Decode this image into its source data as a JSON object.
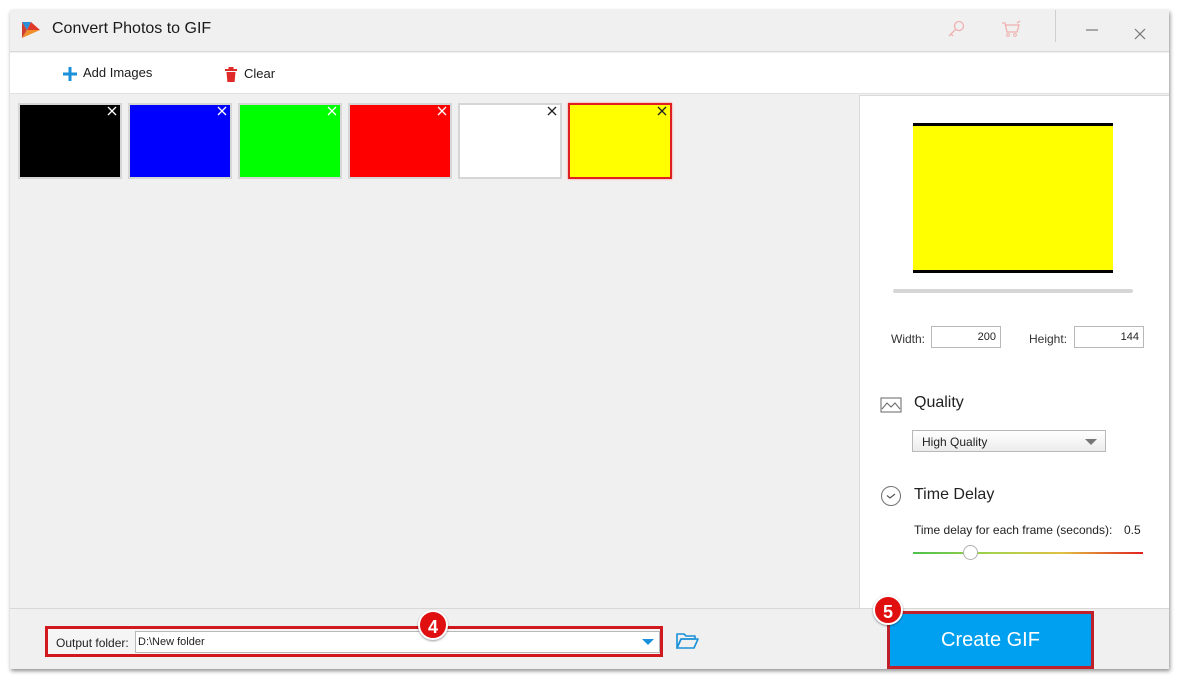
{
  "window": {
    "title": "Convert Photos to GIF",
    "icons": {
      "logo": "app-logo-icon",
      "key": "key-icon",
      "cart": "cart-icon",
      "minimize": "minimize-icon",
      "close": "close-icon"
    }
  },
  "toolbar": {
    "add_images_label": "Add Images",
    "clear_label": "Clear"
  },
  "thumbnails": [
    {
      "color": "#000000",
      "name": "black",
      "selected": false
    },
    {
      "color": "#0000ff",
      "name": "blue",
      "selected": false
    },
    {
      "color": "#00ff00",
      "name": "green",
      "selected": false
    },
    {
      "color": "#ff0000",
      "name": "red",
      "selected": false
    },
    {
      "color": "#ffffff",
      "name": "white",
      "selected": false
    },
    {
      "color": "#ffff00",
      "name": "yellow",
      "selected": true
    }
  ],
  "preview": {
    "color": "#ffff00",
    "width_label": "Width:",
    "width_value": "200",
    "height_label": "Height:",
    "height_value": "144"
  },
  "quality": {
    "title": "Quality",
    "selected": "High Quality"
  },
  "time_delay": {
    "title": "Time Delay",
    "label": "Time delay for each frame (seconds):",
    "value": "0.5",
    "slider_fraction": 0.25
  },
  "output": {
    "label": "Output folder:",
    "value": "D:\\New folder"
  },
  "annotations": {
    "badge_4": "4",
    "badge_5": "5"
  },
  "create_button": {
    "label": "Create GIF"
  },
  "colors": {
    "accent": "#00a0f0",
    "highlight": "#d0181e"
  }
}
